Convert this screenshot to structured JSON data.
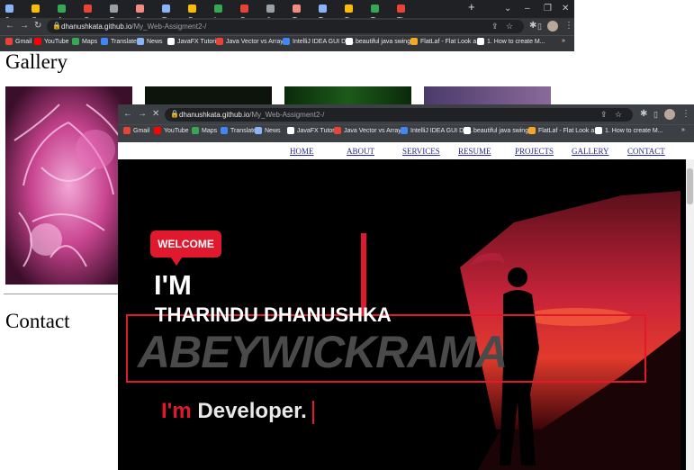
{
  "back_window": {
    "tabs": [
      "9",
      "G",
      "A",
      "G",
      "P",
      "S",
      "R",
      "S",
      "L",
      "S",
      "J",
      "T",
      "T",
      "D",
      "T",
      "Tl"
    ],
    "new_tab": "+",
    "url_domain": "dhanushkata.github.io",
    "url_path": "/My_Web-Assigment2-/",
    "bookmarks": [
      "Gmail",
      "YouTube",
      "Maps",
      "Translate",
      "News",
      "JavaFX Tutorial",
      "Java Vector vs Array...",
      "IntelliJ IDEA GUI De...",
      "beautiful java swing...",
      "FlatLaf - Flat Look a...",
      "1. How to create M..."
    ],
    "page": {
      "gallery_heading": "Gallery",
      "contact_heading": "Contact"
    }
  },
  "front_window": {
    "url_domain": "dhanushkata.github.io",
    "url_path": "/My_Web-Assigment2-/",
    "bookmarks": [
      "Gmail",
      "YouTube",
      "Maps",
      "Translate",
      "News",
      "JavaFX Tutorial",
      "Java Vector vs Array...",
      "IntelliJ IDEA GUI De...",
      "beautiful java swing...",
      "FlatLaf - Flat Look a...",
      "1. How to create M..."
    ],
    "nav": [
      "HOME",
      "ABOUT",
      "SERVICES",
      "RESUME",
      "PROJECTS",
      "GALLERY",
      "CONTACT"
    ],
    "hero": {
      "badge": "WELCOME",
      "im": "I'M",
      "first_name": "THARINDU DHANUSHKA",
      "last_name": "ABEYWICKRAMA",
      "typed_prefix": "I'm",
      "typed_word": "Developer."
    }
  },
  "colors": {
    "accent": "#e0192f",
    "chrome_dark": "#202124",
    "chrome": "#35363a"
  }
}
